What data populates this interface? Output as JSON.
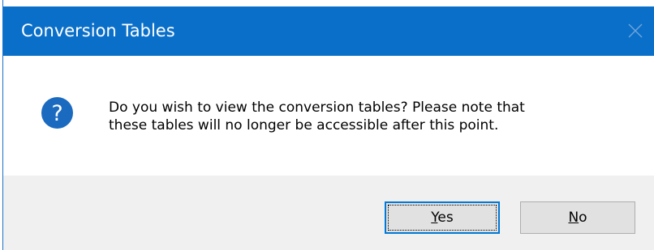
{
  "window": {
    "title": "Conversion Tables",
    "close_icon": "close-icon"
  },
  "message": {
    "icon": "question-icon",
    "line1": "Do you wish to view the conversion tables? Please note that",
    "line2": "these tables will no longer be accessible after this point."
  },
  "buttons": {
    "yes": {
      "mnemonic": "Y",
      "rest": "es"
    },
    "no": {
      "mnemonic": "N",
      "rest": "o"
    }
  },
  "colors": {
    "titlebar": "#0a6fc9",
    "icon": "#1a6ac0",
    "footer": "#f0f0f0",
    "focus": "#0078d7"
  }
}
